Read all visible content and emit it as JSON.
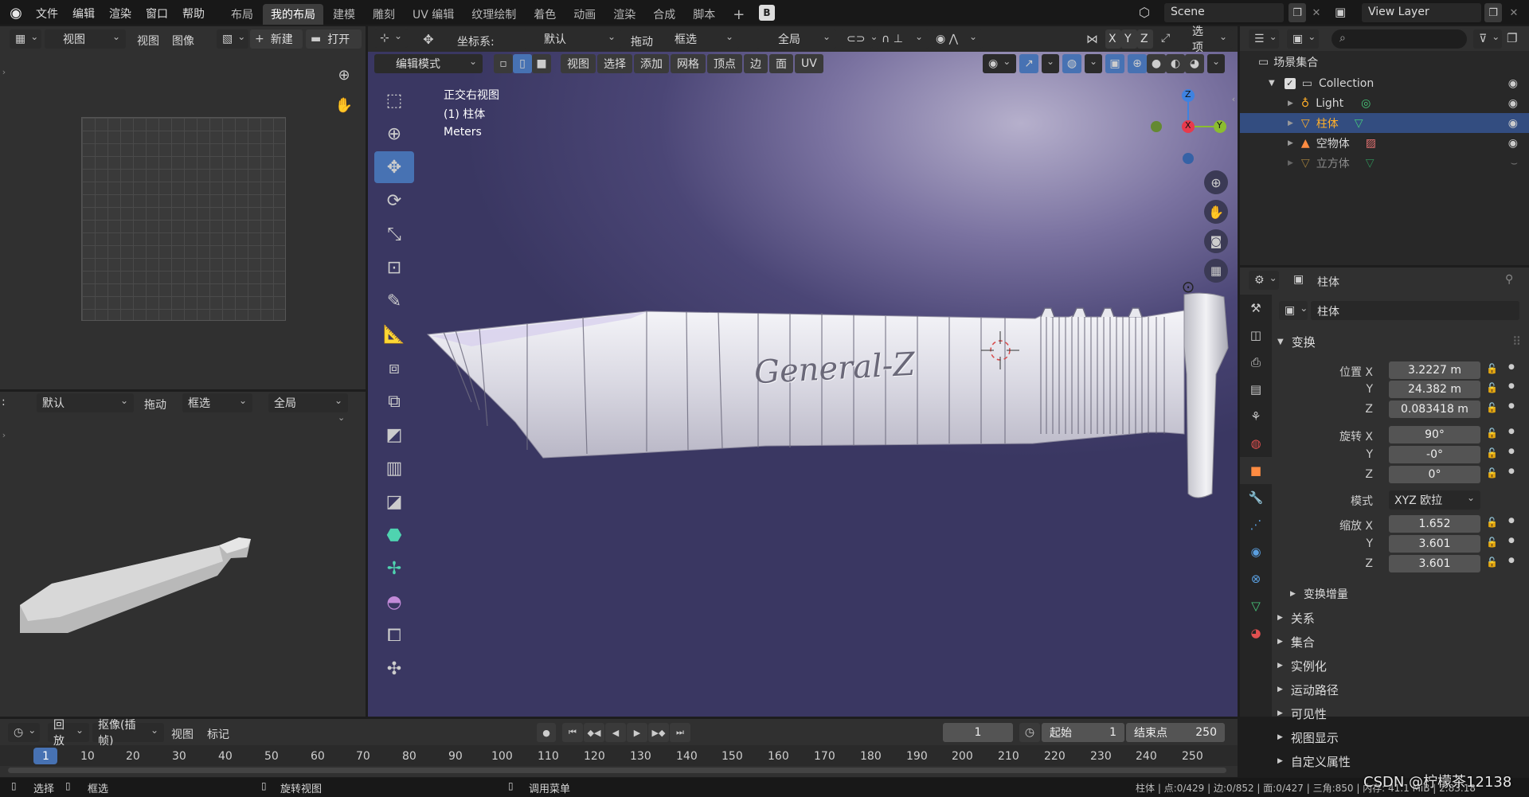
{
  "topbar": {
    "menus": [
      "文件",
      "编辑",
      "渲染",
      "窗口",
      "帮助"
    ],
    "workspaces": [
      "布局",
      "我的布局",
      "建模",
      "雕刻",
      "UV 编辑",
      "纹理绘制",
      "着色",
      "动画",
      "渲染",
      "合成",
      "脚本"
    ],
    "active_workspace": "我的布局",
    "scene_name": "Scene",
    "view_layer": "View Layer"
  },
  "image_editor": {
    "view_dropdown": "视图",
    "menus": [
      "视图",
      "图像"
    ],
    "new_label": "新建",
    "open_label": "打开"
  },
  "left_props_header": {
    "orientation": "默认",
    "drag_label": "拖动",
    "select_mode": "框选",
    "global_label": "全局"
  },
  "viewport_header": {
    "coord_label": "坐标系:",
    "coord_value": "默认",
    "drag_label": "拖动",
    "select_mode": "框选",
    "transform_space": "全局",
    "axis_x": "X",
    "axis_y": "Y",
    "axis_z": "Z",
    "options_label": "选项",
    "mode": "编辑模式",
    "menus": [
      "视图",
      "选择",
      "添加",
      "网格",
      "顶点",
      "边",
      "面",
      "UV"
    ]
  },
  "viewport_overlay": {
    "view_name": "正交右视图",
    "object_line": "(1) 柱体",
    "units": "Meters",
    "blade_text": "General-Z",
    "gizmo_z": "Z",
    "gizmo_x": "X",
    "gizmo_y": "Y"
  },
  "outliner": {
    "root": "场景集合",
    "collection": "Collection",
    "items": [
      {
        "label": "Light",
        "color": "#d6d6d6",
        "selected": false,
        "visible": true
      },
      {
        "label": "柱体",
        "color": "#ffaf29",
        "selected": true,
        "visible": true
      },
      {
        "label": "空物体",
        "color": "#d6d6d6",
        "selected": false,
        "visible": true
      },
      {
        "label": "立方体",
        "color": "#8a8a8a",
        "selected": false,
        "visible": false
      }
    ]
  },
  "properties": {
    "header_title": "柱体",
    "object_name": "柱体",
    "transform_label": "变换",
    "location_label": "位置 X",
    "location": [
      "3.2227 m",
      "24.382 m",
      "0.083418 m"
    ],
    "rotation_label": "旋转 X",
    "rotation": [
      "90°",
      "-0°",
      "0°"
    ],
    "mode_label": "模式",
    "mode_value": "XYZ 欧拉",
    "scale_label": "缩放 X",
    "scale": [
      "1.652",
      "3.601",
      "3.601"
    ],
    "axis_y": "Y",
    "axis_z": "Z",
    "delta_label": "变换增量",
    "sections": [
      "关系",
      "集合",
      "实例化",
      "运动路径",
      "可见性",
      "视图显示",
      "自定义属性"
    ]
  },
  "timeline": {
    "playback": "回放",
    "keying": "抠像(插帧)",
    "view": "视图",
    "marker": "标记",
    "current_frame": "1",
    "start_label": "起始",
    "start": "1",
    "end_label": "结束点",
    "end": "250",
    "ticks": [
      "1",
      "10",
      "20",
      "30",
      "40",
      "50",
      "60",
      "70",
      "80",
      "90",
      "100",
      "110",
      "120",
      "130",
      "140",
      "150",
      "160",
      "170",
      "180",
      "190",
      "200",
      "210",
      "220",
      "230",
      "240",
      "250"
    ]
  },
  "statusbar": {
    "select": "选择",
    "box_select": "框选",
    "rotate_view": "旋转视图",
    "call_menu": "调用菜单",
    "stats": "柱体 | 点:0/429 | 边:0/852 | 面:0/427 | 三角:850 | 内存: 41.1 MiB | 2.83.18",
    "watermark": "CSDN @柠檬茶12138"
  },
  "colors": {
    "accent": "#4772b3",
    "selected_row": "#334d80",
    "object_orange": "#ffaf29",
    "x_axis": "#e83a4c",
    "y_axis": "#8bbd2f",
    "z_axis": "#3e82e0"
  }
}
